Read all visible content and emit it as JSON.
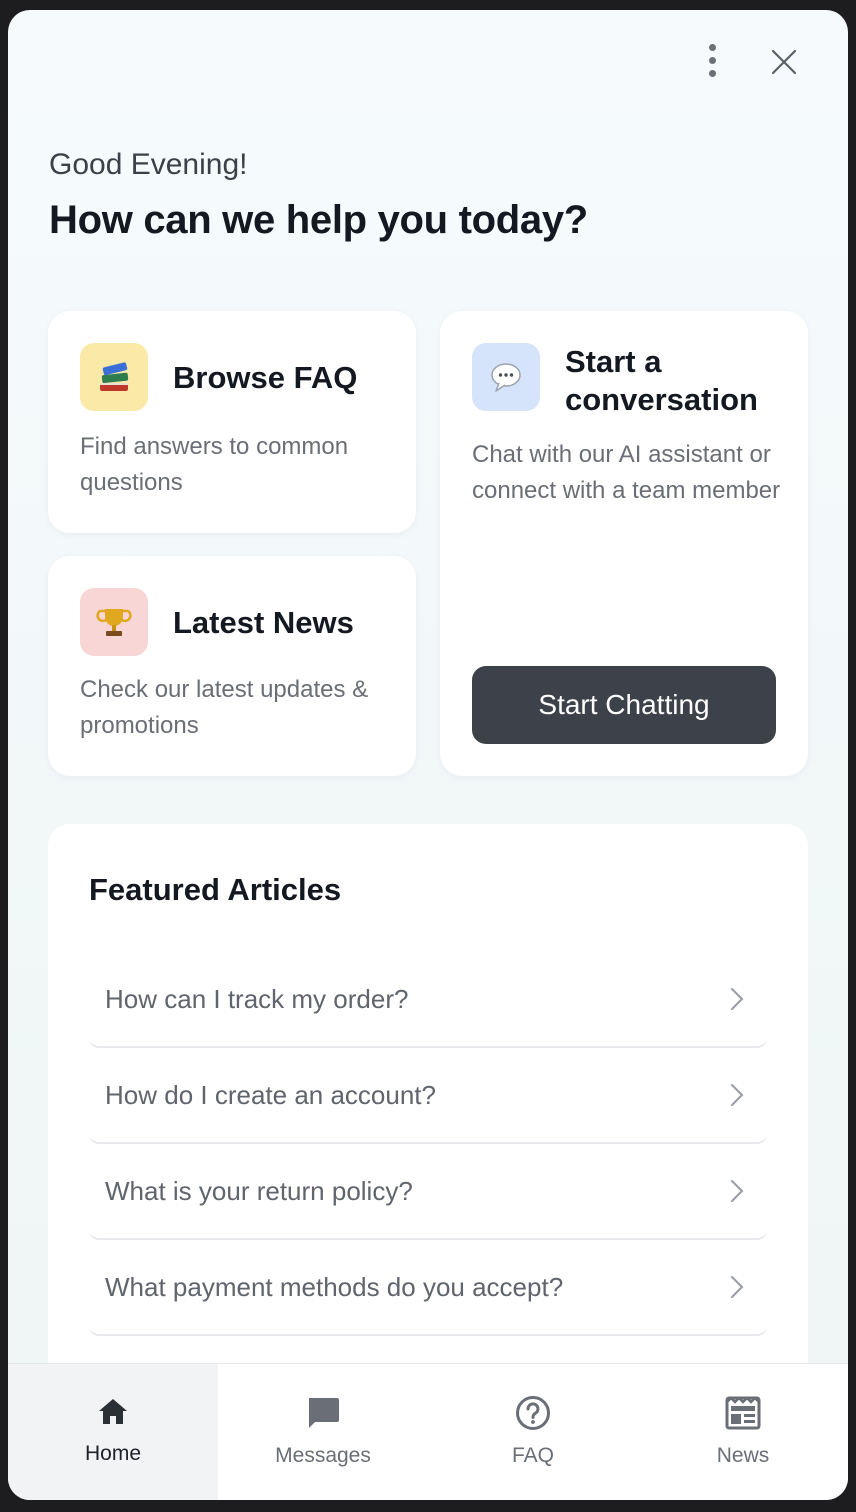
{
  "greeting": "Good Evening!",
  "headline": "How can we help you today?",
  "cards": {
    "faq": {
      "title": "Browse FAQ",
      "description": "Find answers to common questions",
      "icon": "books-icon"
    },
    "news": {
      "title": "Latest News",
      "description": "Check our latest updates & promotions",
      "icon": "trophy-icon"
    },
    "chat": {
      "title": "Start a conversation",
      "description": "Chat with our AI assistant or connect with a team member",
      "icon": "speech-bubble-icon",
      "button_label": "Start Chatting"
    }
  },
  "featured": {
    "title": "Featured Articles",
    "items": [
      "How can I track my order?",
      "How do I create an account?",
      "What is your return policy?",
      "What payment methods do you accept?"
    ]
  },
  "nav": {
    "items": [
      {
        "label": "Home",
        "icon": "home-icon",
        "active": true
      },
      {
        "label": "Messages",
        "icon": "message-icon",
        "active": false
      },
      {
        "label": "FAQ",
        "icon": "help-circle-icon",
        "active": false
      },
      {
        "label": "News",
        "icon": "newspaper-icon",
        "active": false
      }
    ]
  },
  "colors": {
    "primary_button": "#3d424a",
    "heading": "#141821",
    "muted_text": "#6a6e76",
    "tile_yellow": "#fbe9a8",
    "tile_pink": "#f8d6d6",
    "tile_blue": "#d6e4fb"
  }
}
